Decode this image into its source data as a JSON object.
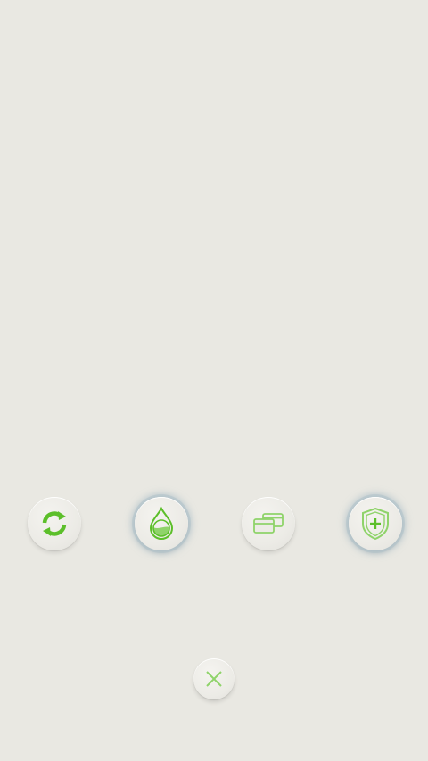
{
  "toolbar": {
    "buttons": [
      {
        "id": "refresh",
        "icon": "refresh-icon",
        "glow": false
      },
      {
        "id": "water",
        "icon": "water-drop-icon",
        "glow": true
      },
      {
        "id": "cards",
        "icon": "cards-icon",
        "glow": false
      },
      {
        "id": "shield",
        "icon": "shield-plus-icon",
        "glow": true
      }
    ]
  },
  "close": {
    "icon": "close-icon"
  },
  "colors": {
    "background": "#e9e8e2",
    "accent_green": "#5cbf2a",
    "light_green": "#8fd36a",
    "glow": "#9fb4c2"
  }
}
